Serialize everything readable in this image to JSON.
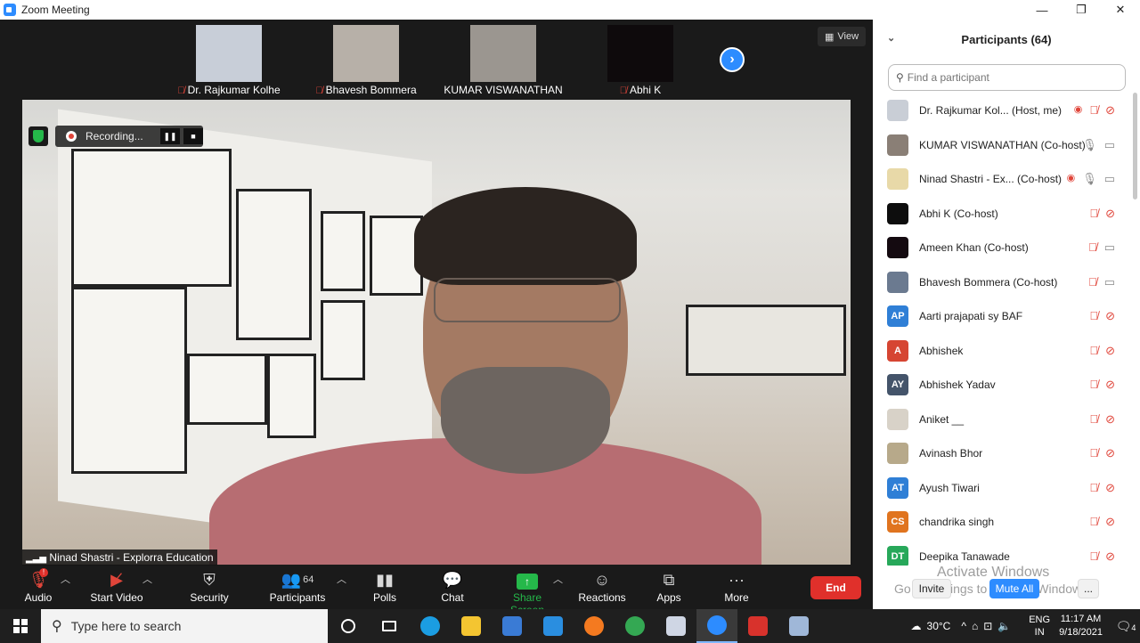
{
  "window": {
    "title": "Zoom Meeting",
    "min": "—",
    "restore": "❐",
    "close": "✕"
  },
  "thumbnails": [
    {
      "name": "Dr. Rajkumar Kolhe",
      "muted": true,
      "color": "#c8ced8"
    },
    {
      "name": "Bhavesh Bommera",
      "muted": true,
      "color": "#b7b0a8"
    },
    {
      "name": "KUMAR VISWANATHAN",
      "muted": false,
      "color": "#9b9690"
    },
    {
      "name": "Abhi K",
      "muted": true,
      "color": "#0e0a0c"
    }
  ],
  "view_label": "View",
  "recording_label": "Recording...",
  "speaker_label": "Ninad Shastri - Explorra Education",
  "toolbar": {
    "audio": "Audio",
    "start_video": "Start Video",
    "security": "Security",
    "participants": "Participants",
    "participants_count": "64",
    "polls": "Polls",
    "chat": "Chat",
    "share_screen": "Share Screen",
    "reactions": "Reactions",
    "apps": "Apps",
    "more": "More",
    "end": "End",
    "alert_badge": "!"
  },
  "panel": {
    "title": "Participants (64)",
    "search_placeholder": "Find a participant",
    "participants": [
      {
        "name": "Dr. Rajkumar Kol... (Host, me)",
        "avatar_text": "",
        "avatar_color": "#c9ced6",
        "rec": true,
        "mic": "off",
        "video": "off"
      },
      {
        "name": "KUMAR VISWANATHAN (Co-host)",
        "avatar_text": "",
        "avatar_color": "#8a7f76",
        "rec": false,
        "mic": "on",
        "video": "on"
      },
      {
        "name": "Ninad Shastri - Ex... (Co-host)",
        "avatar_text": "",
        "avatar_color": "#e8d9a8",
        "rec": true,
        "mic": "on",
        "video": "on"
      },
      {
        "name": "Abhi K (Co-host)",
        "avatar_text": "",
        "avatar_color": "#0d0d0d",
        "rec": false,
        "mic": "off",
        "video": "off"
      },
      {
        "name": "Ameen Khan (Co-host)",
        "avatar_text": "",
        "avatar_color": "#140a10",
        "rec": false,
        "mic": "off",
        "video": "on"
      },
      {
        "name": "Bhavesh Bommera (Co-host)",
        "avatar_text": "",
        "avatar_color": "#6b7a90",
        "rec": false,
        "mic": "off",
        "video": "on"
      },
      {
        "name": "Aarti prajapati sy BAF",
        "avatar_text": "AP",
        "avatar_color": "#2f7fd6",
        "rec": false,
        "mic": "off",
        "video": "off"
      },
      {
        "name": "Abhishek",
        "avatar_text": "A",
        "avatar_color": "#d64532",
        "rec": false,
        "mic": "off",
        "video": "off"
      },
      {
        "name": "Abhishek Yadav",
        "avatar_text": "AY",
        "avatar_color": "#44546a",
        "rec": false,
        "mic": "off",
        "video": "off"
      },
      {
        "name": "Aniket __",
        "avatar_text": "",
        "avatar_color": "#d8d2c8",
        "rec": false,
        "mic": "off",
        "video": "off"
      },
      {
        "name": "Avinash Bhor",
        "avatar_text": "",
        "avatar_color": "#b7a98a",
        "rec": false,
        "mic": "off",
        "video": "off"
      },
      {
        "name": "Ayush Tiwari",
        "avatar_text": "AT",
        "avatar_color": "#2f7fd6",
        "rec": false,
        "mic": "off",
        "video": "off"
      },
      {
        "name": "chandrika singh",
        "avatar_text": "CS",
        "avatar_color": "#e0741f",
        "rec": false,
        "mic": "off",
        "video": "off"
      },
      {
        "name": "Deepika Tanawade",
        "avatar_text": "DT",
        "avatar_color": "#27a85a",
        "rec": false,
        "mic": "off",
        "video": "off"
      }
    ],
    "invite": "Invite",
    "mute_all": "Mute All",
    "more": "..."
  },
  "activate": {
    "line1": "Activate Windows",
    "line2": "Go to Settings to activate Windows."
  },
  "taskbar": {
    "search_placeholder": "Type here to search",
    "temp": "30°C",
    "lang1": "ENG",
    "lang2": "IN",
    "time": "11:17 AM",
    "date": "9/18/2021",
    "notif_count": "4",
    "apps": [
      {
        "name": "cortana",
        "color": "#ffffff"
      },
      {
        "name": "task-view",
        "color": "#ffffff"
      },
      {
        "name": "edge",
        "color": "#1b9de2"
      },
      {
        "name": "file-explorer",
        "color": "#f4c531"
      },
      {
        "name": "store",
        "color": "#3a7bd5"
      },
      {
        "name": "mail",
        "color": "#2a8ee0"
      },
      {
        "name": "firefox",
        "color": "#f47a20"
      },
      {
        "name": "chrome",
        "color": "#34a853"
      },
      {
        "name": "notes",
        "color": "#cfd6e4"
      },
      {
        "name": "zoom",
        "color": "#2d8cff"
      },
      {
        "name": "wps",
        "color": "#d8322c"
      },
      {
        "name": "app",
        "color": "#9fb7d8"
      }
    ]
  }
}
